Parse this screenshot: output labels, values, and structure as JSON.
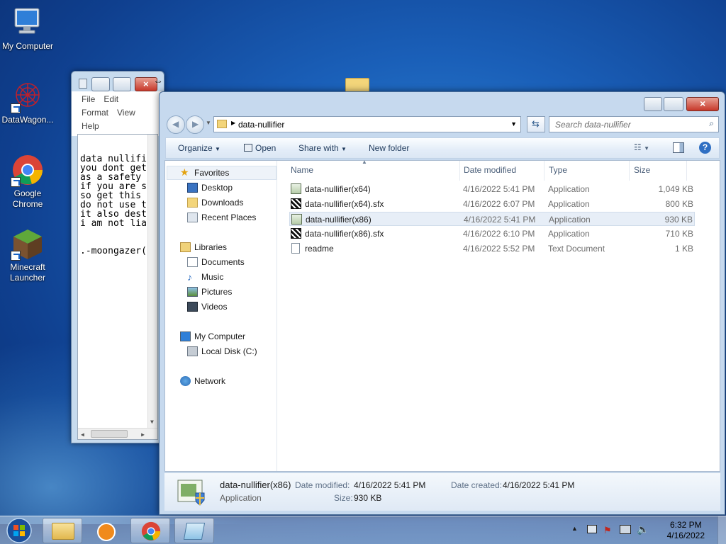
{
  "desktop": {
    "icons": [
      {
        "label": "My Computer"
      },
      {
        "label": "DataWagon..."
      },
      {
        "label": "Google Chrome"
      },
      {
        "label": "Minecraft Launcher"
      }
    ]
  },
  "notepad": {
    "menu": [
      "File",
      "Edit",
      "Format",
      "View",
      "Help"
    ],
    "text": "data nullifi\nyou dont get\nas a safety \nif you are s\nso get this \ndo not use t\nit also dest\ni am not lia\n\n\n.-moongazer("
  },
  "explorer": {
    "address": {
      "folder": "data-nullifier"
    },
    "search": {
      "placeholder": "Search data-nullifier"
    },
    "toolbar": {
      "organize": "Organize",
      "open": "Open",
      "share_with": "Share with",
      "new_folder": "New folder"
    },
    "nav": {
      "favorites": "Favorites",
      "favorites_items": [
        "Desktop",
        "Downloads",
        "Recent Places"
      ],
      "libraries": "Libraries",
      "libraries_items": [
        "Documents",
        "Music",
        "Pictures",
        "Videos"
      ],
      "computer": "My Computer",
      "computer_items": [
        "Local Disk (C:)"
      ],
      "network": "Network"
    },
    "columns": {
      "name": "Name",
      "date": "Date modified",
      "type": "Type",
      "size": "Size"
    },
    "files": [
      {
        "name": "data-nullifier(x64)",
        "date": "4/16/2022 5:41 PM",
        "type": "Application",
        "size": "1,049 KB",
        "icon": "app-icon"
      },
      {
        "name": "data-nullifier(x64).sfx",
        "date": "4/16/2022 6:07 PM",
        "type": "Application",
        "size": "800 KB",
        "icon": "sfx-icon"
      },
      {
        "name": "data-nullifier(x86)",
        "date": "4/16/2022 5:41 PM",
        "type": "Application",
        "size": "930 KB",
        "icon": "app-icon"
      },
      {
        "name": "data-nullifier(x86).sfx",
        "date": "4/16/2022 6:10 PM",
        "type": "Application",
        "size": "710 KB",
        "icon": "sfx-icon"
      },
      {
        "name": "readme",
        "date": "4/16/2022 5:52 PM",
        "type": "Text Document",
        "size": "1 KB",
        "icon": "text-file-icon"
      }
    ],
    "details": {
      "name": "data-nullifier(x86)",
      "type": "Application",
      "modified_label": "Date modified:",
      "modified_value": "4/16/2022 5:41 PM",
      "created_label": "Date created:",
      "created_value": "4/16/2022 5:41 PM",
      "size_label": "Size:",
      "size_value": "930 KB"
    }
  },
  "taskbar": {
    "clock_time": "6:32 PM",
    "clock_date": "4/16/2022"
  },
  "colors": {
    "selection": "#e7eef7",
    "link_text": "#1e395b",
    "desktop_blue": "#1a5fb8"
  }
}
